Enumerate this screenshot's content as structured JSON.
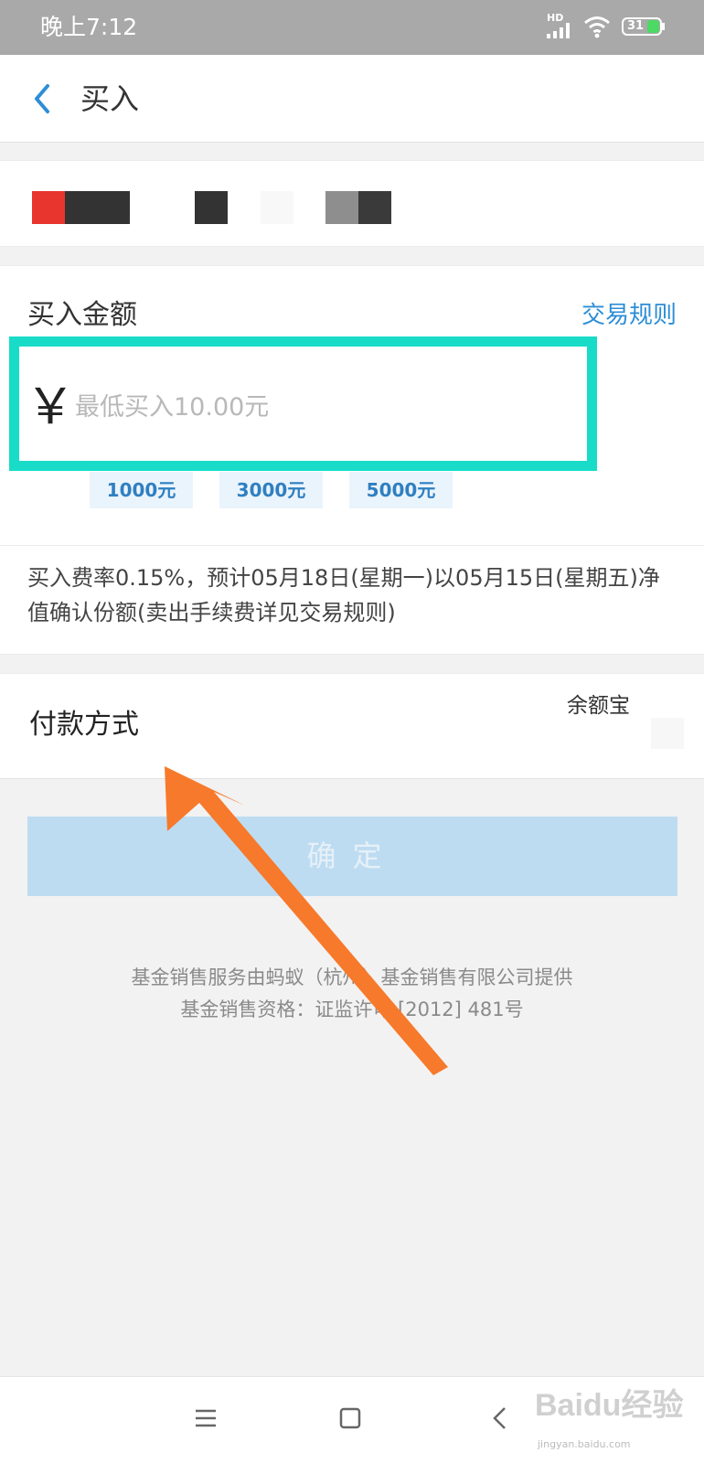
{
  "status_bar": {
    "time": "晚上7:12",
    "network_label": "HD",
    "battery": "31",
    "icons": [
      "signal-icon",
      "wifi-icon",
      "battery-icon"
    ]
  },
  "nav": {
    "back_icon": "chevron-left-icon",
    "title": "买入"
  },
  "amount": {
    "label": "买入金额",
    "rules_link": "交易规则",
    "currency_symbol": "￥",
    "placeholder": "最低买入10.00元",
    "quick_amounts": [
      "1000元",
      "3000元",
      "5000元"
    ],
    "fee_text": "买入费率0.15%，预计05月18日(星期一)以05月15日(星期五)净值确认份额(卖出手续费详见交易规则)"
  },
  "payment": {
    "label": "付款方式",
    "value": "余额宝"
  },
  "confirm_label": "确定",
  "footer": {
    "line1": "基金销售服务由蚂蚁（杭州）基金销售有限公司提供",
    "line2": "基金销售资格：证监许可 [2012] 481号"
  },
  "system_nav": [
    "menu-icon",
    "home-icon",
    "back-icon"
  ],
  "watermark": {
    "text": "Baidu经验",
    "sub": "jingyan.baidu.com"
  },
  "colors": {
    "accent": "#2d8ed6",
    "highlight": "#18dcc8",
    "arrow": "#f7792b",
    "confirm_disabled": "#bddcf1"
  }
}
